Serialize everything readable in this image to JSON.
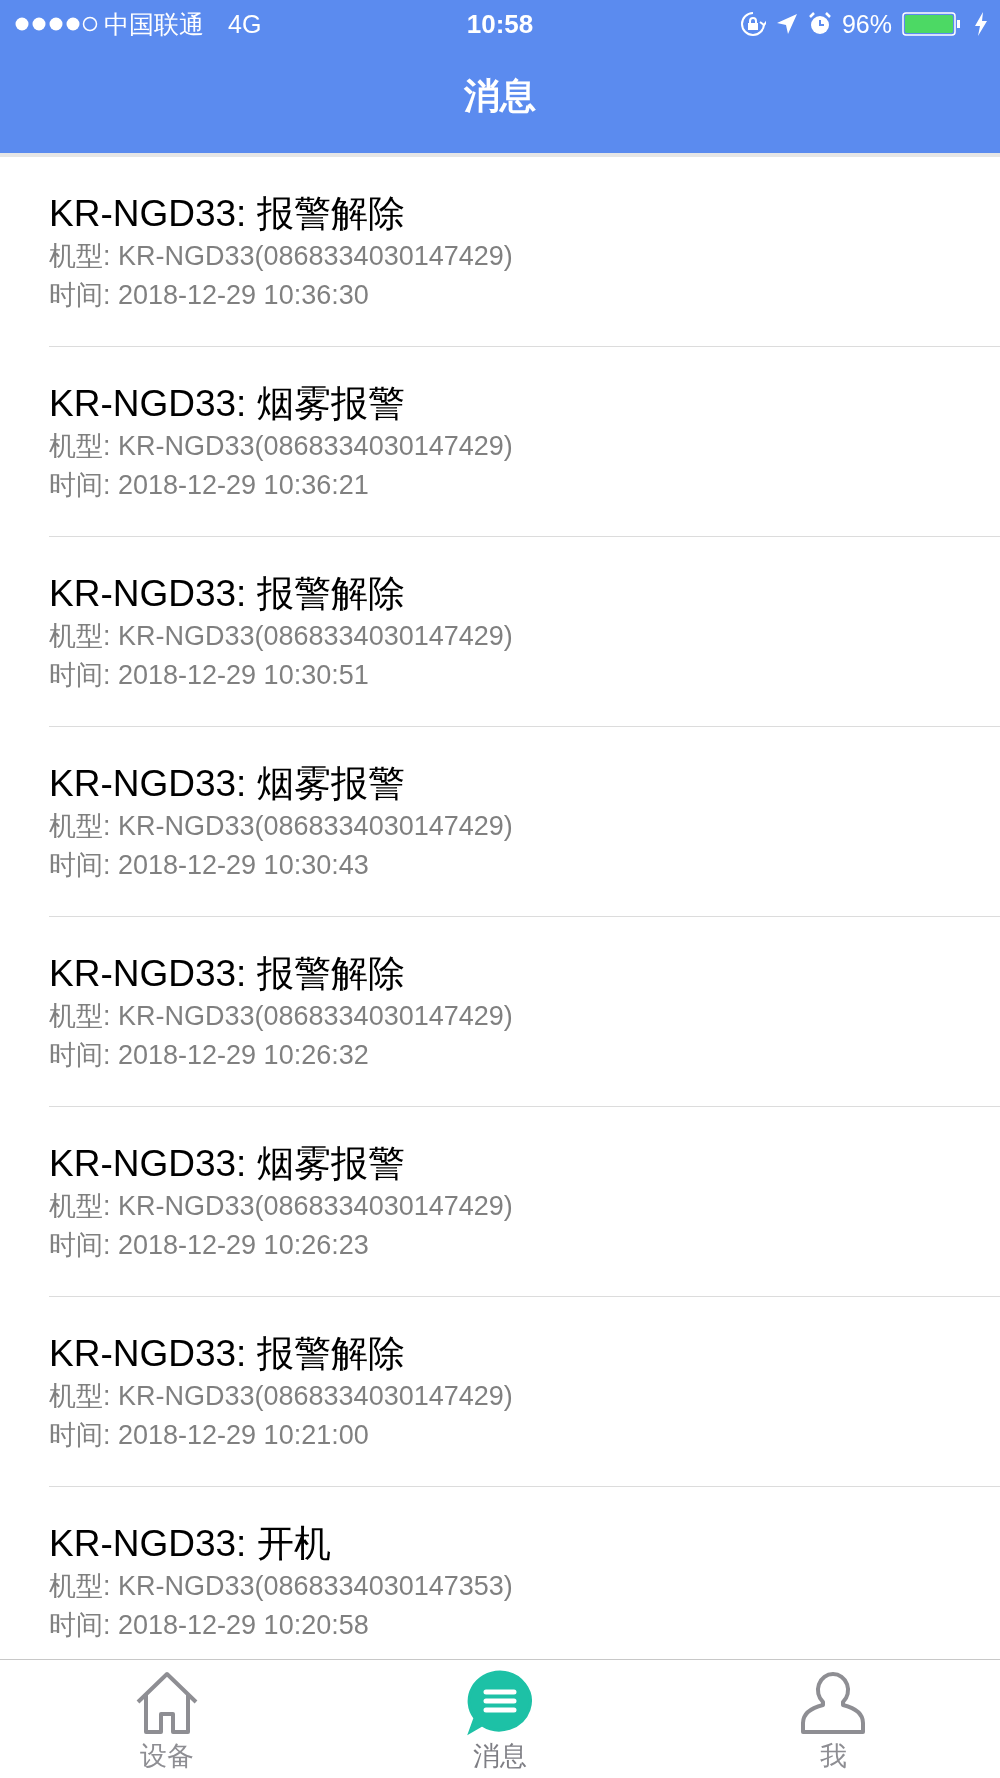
{
  "status_bar": {
    "carrier": "中国联通",
    "network": "4G",
    "time": "10:58",
    "battery": "96%"
  },
  "nav_bar": {
    "title": "消息"
  },
  "messages": [
    {
      "title": "KR-NGD33: 报警解除",
      "model": "机型: KR-NGD33(0868334030147429)",
      "time": "时间: 2018-12-29 10:36:30"
    },
    {
      "title": "KR-NGD33: 烟雾报警",
      "model": "机型: KR-NGD33(0868334030147429)",
      "time": "时间: 2018-12-29 10:36:21"
    },
    {
      "title": "KR-NGD33: 报警解除",
      "model": "机型: KR-NGD33(0868334030147429)",
      "time": "时间: 2018-12-29 10:30:51"
    },
    {
      "title": "KR-NGD33: 烟雾报警",
      "model": "机型: KR-NGD33(0868334030147429)",
      "time": "时间: 2018-12-29 10:30:43"
    },
    {
      "title": "KR-NGD33: 报警解除",
      "model": "机型: KR-NGD33(0868334030147429)",
      "time": "时间: 2018-12-29 10:26:32"
    },
    {
      "title": "KR-NGD33: 烟雾报警",
      "model": "机型: KR-NGD33(0868334030147429)",
      "time": "时间: 2018-12-29 10:26:23"
    },
    {
      "title": "KR-NGD33: 报警解除",
      "model": "机型: KR-NGD33(0868334030147429)",
      "time": "时间: 2018-12-29 10:21:00"
    },
    {
      "title": "KR-NGD33: 开机",
      "model": "机型: KR-NGD33(0868334030147353)",
      "time": "时间: 2018-12-29 10:20:58"
    }
  ],
  "tab_bar": [
    {
      "kind": "home",
      "label": "设备",
      "selected": false
    },
    {
      "kind": "messages",
      "label": "消息",
      "selected": true
    },
    {
      "kind": "me",
      "label": "我",
      "selected": false
    }
  ]
}
